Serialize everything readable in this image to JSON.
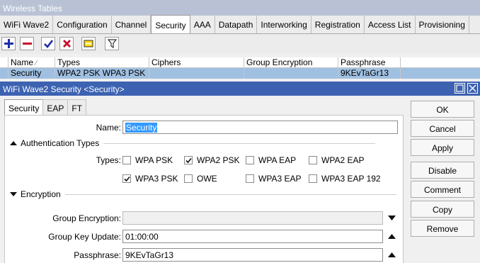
{
  "window": {
    "title": "Wireless Tables"
  },
  "tabs": [
    "WiFi Wave2",
    "Configuration",
    "Channel",
    "Security",
    "AAA",
    "Datapath",
    "Interworking",
    "Registration",
    "Access List",
    "Provisioning"
  ],
  "active_tab": "Security",
  "table": {
    "headers": [
      "Name",
      "Types",
      "Ciphers",
      "Group Encryption",
      "Passphrase"
    ],
    "rows": [
      {
        "name": "Security",
        "types": "WPA2 PSK WPA3 PSK",
        "ciphers": "",
        "group_encryption": "",
        "passphrase": "9KEvTaGr13"
      }
    ]
  },
  "dialog": {
    "title": "WiFi Wave2 Security <Security>",
    "tabs": [
      "Security",
      "EAP",
      "FT"
    ],
    "name_label": "Name:",
    "name_value": "Security",
    "auth_section": "Authentication Types",
    "types_label": "Types:",
    "types": [
      {
        "label": "WPA PSK",
        "checked": false
      },
      {
        "label": "WPA2 PSK",
        "checked": true
      },
      {
        "label": "WPA EAP",
        "checked": false
      },
      {
        "label": "WPA2 EAP",
        "checked": false
      },
      {
        "label": "WPA3 PSK",
        "checked": true
      },
      {
        "label": "OWE",
        "checked": false
      },
      {
        "label": "WPA3 EAP",
        "checked": false
      },
      {
        "label": "WPA3 EAP 192",
        "checked": false
      }
    ],
    "enc_section": "Encryption",
    "group_enc_label": "Group Encryption:",
    "group_enc_value": "",
    "group_key_label": "Group Key Update:",
    "group_key_value": "01:00:00",
    "pass_label": "Passphrase:",
    "pass_value": "9KEvTaGr13",
    "buttons": [
      "OK",
      "Cancel",
      "Apply",
      "Disable",
      "Comment",
      "Copy",
      "Remove"
    ]
  },
  "colors": {
    "dialog_title_bar": "#3c62b1",
    "selected_row": "#a0c0e2",
    "outer_title_bar": "#b9c2d5"
  }
}
